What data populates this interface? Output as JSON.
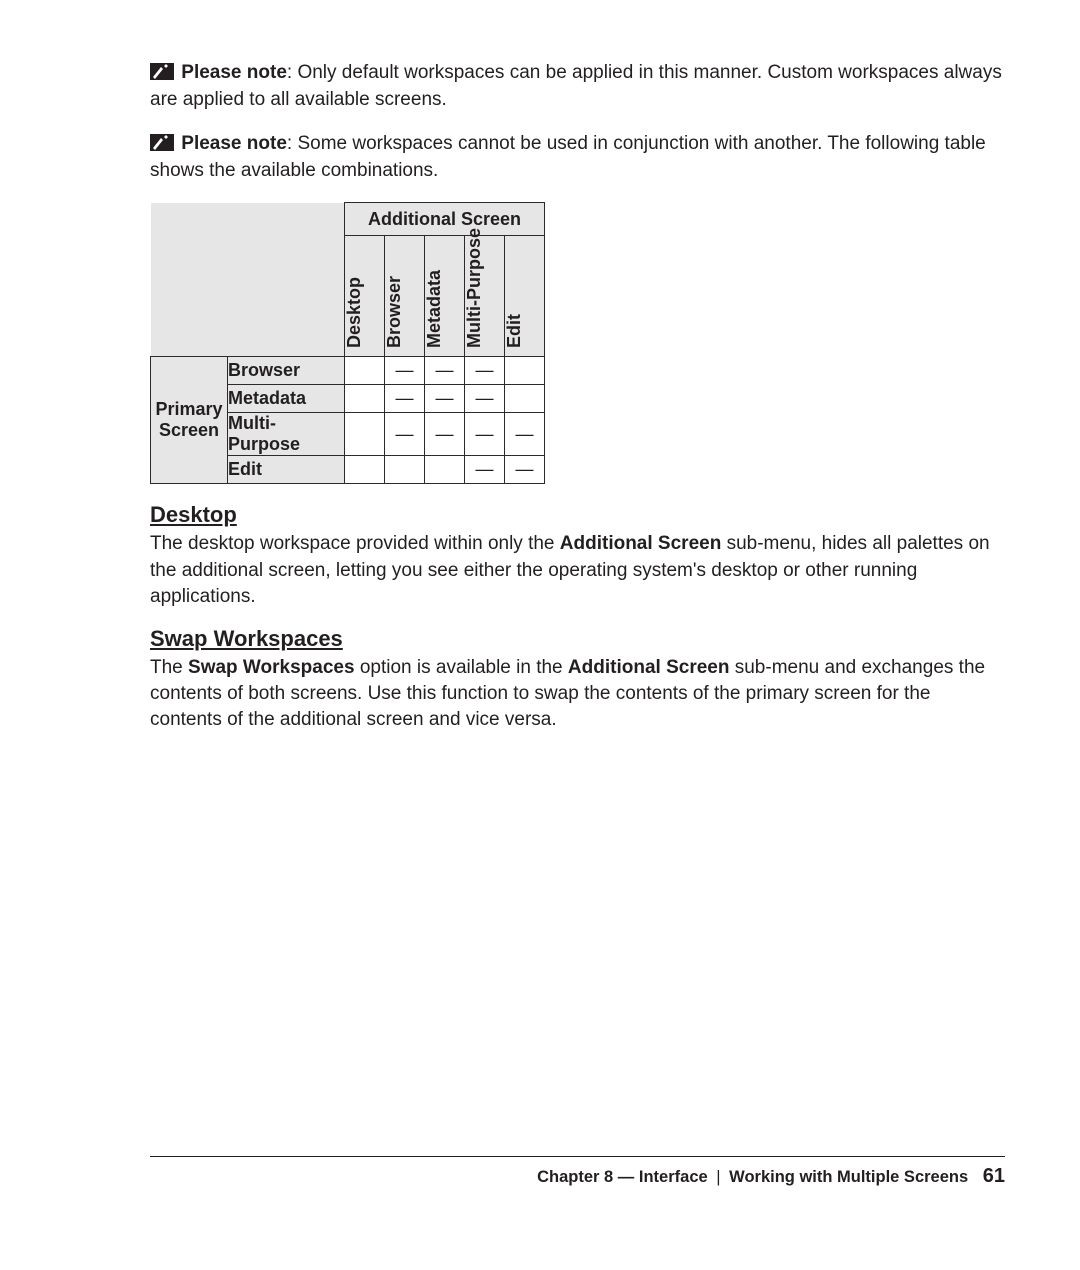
{
  "notes": [
    {
      "label": "Please note",
      "text": ": Only default workspaces can be applied in this manner. Custom workspaces always are applied to all available screens."
    },
    {
      "label": "Please note",
      "text": ": Some workspaces cannot be used in conjunction with another. The following table shows the available combinations."
    }
  ],
  "table": {
    "top_header": "Additional Screen",
    "columns": [
      "Desktop",
      "Browser",
      "Metadata",
      "Multi-Purpose",
      "Edit"
    ],
    "row_group_label": "Primary Screen",
    "rows": [
      {
        "label": "Browser",
        "cells": [
          "",
          "—",
          "—",
          "—",
          ""
        ]
      },
      {
        "label": "Metadata",
        "cells": [
          "",
          "—",
          "—",
          "—",
          ""
        ]
      },
      {
        "label": "Multi-Purpose",
        "cells": [
          "",
          "—",
          "—",
          "—",
          "—"
        ]
      },
      {
        "label": "Edit",
        "cells": [
          "",
          "",
          "",
          "—",
          "—"
        ]
      }
    ]
  },
  "sections": {
    "desktop": {
      "heading": "Desktop",
      "p_pre": "The desktop workspace provided within only the ",
      "p_bold": "Additional Screen",
      "p_post": " sub-menu, hides all palettes on the additional screen, letting you see either the operating system's desktop or other running applications."
    },
    "swap": {
      "heading": "Swap Workspaces",
      "p_pre": "The ",
      "p_b1": "Swap Workspaces",
      "p_mid": " option is available in the ",
      "p_b2": "Additional Screen",
      "p_post": " sub-menu and exchanges the contents of both screens. Use this function to swap the contents of the primary screen for the contents of the additional screen and vice versa."
    }
  },
  "footer": {
    "chapter": "Chapter 8 — Interface",
    "section": "Working with Multiple Screens",
    "page": "61"
  }
}
